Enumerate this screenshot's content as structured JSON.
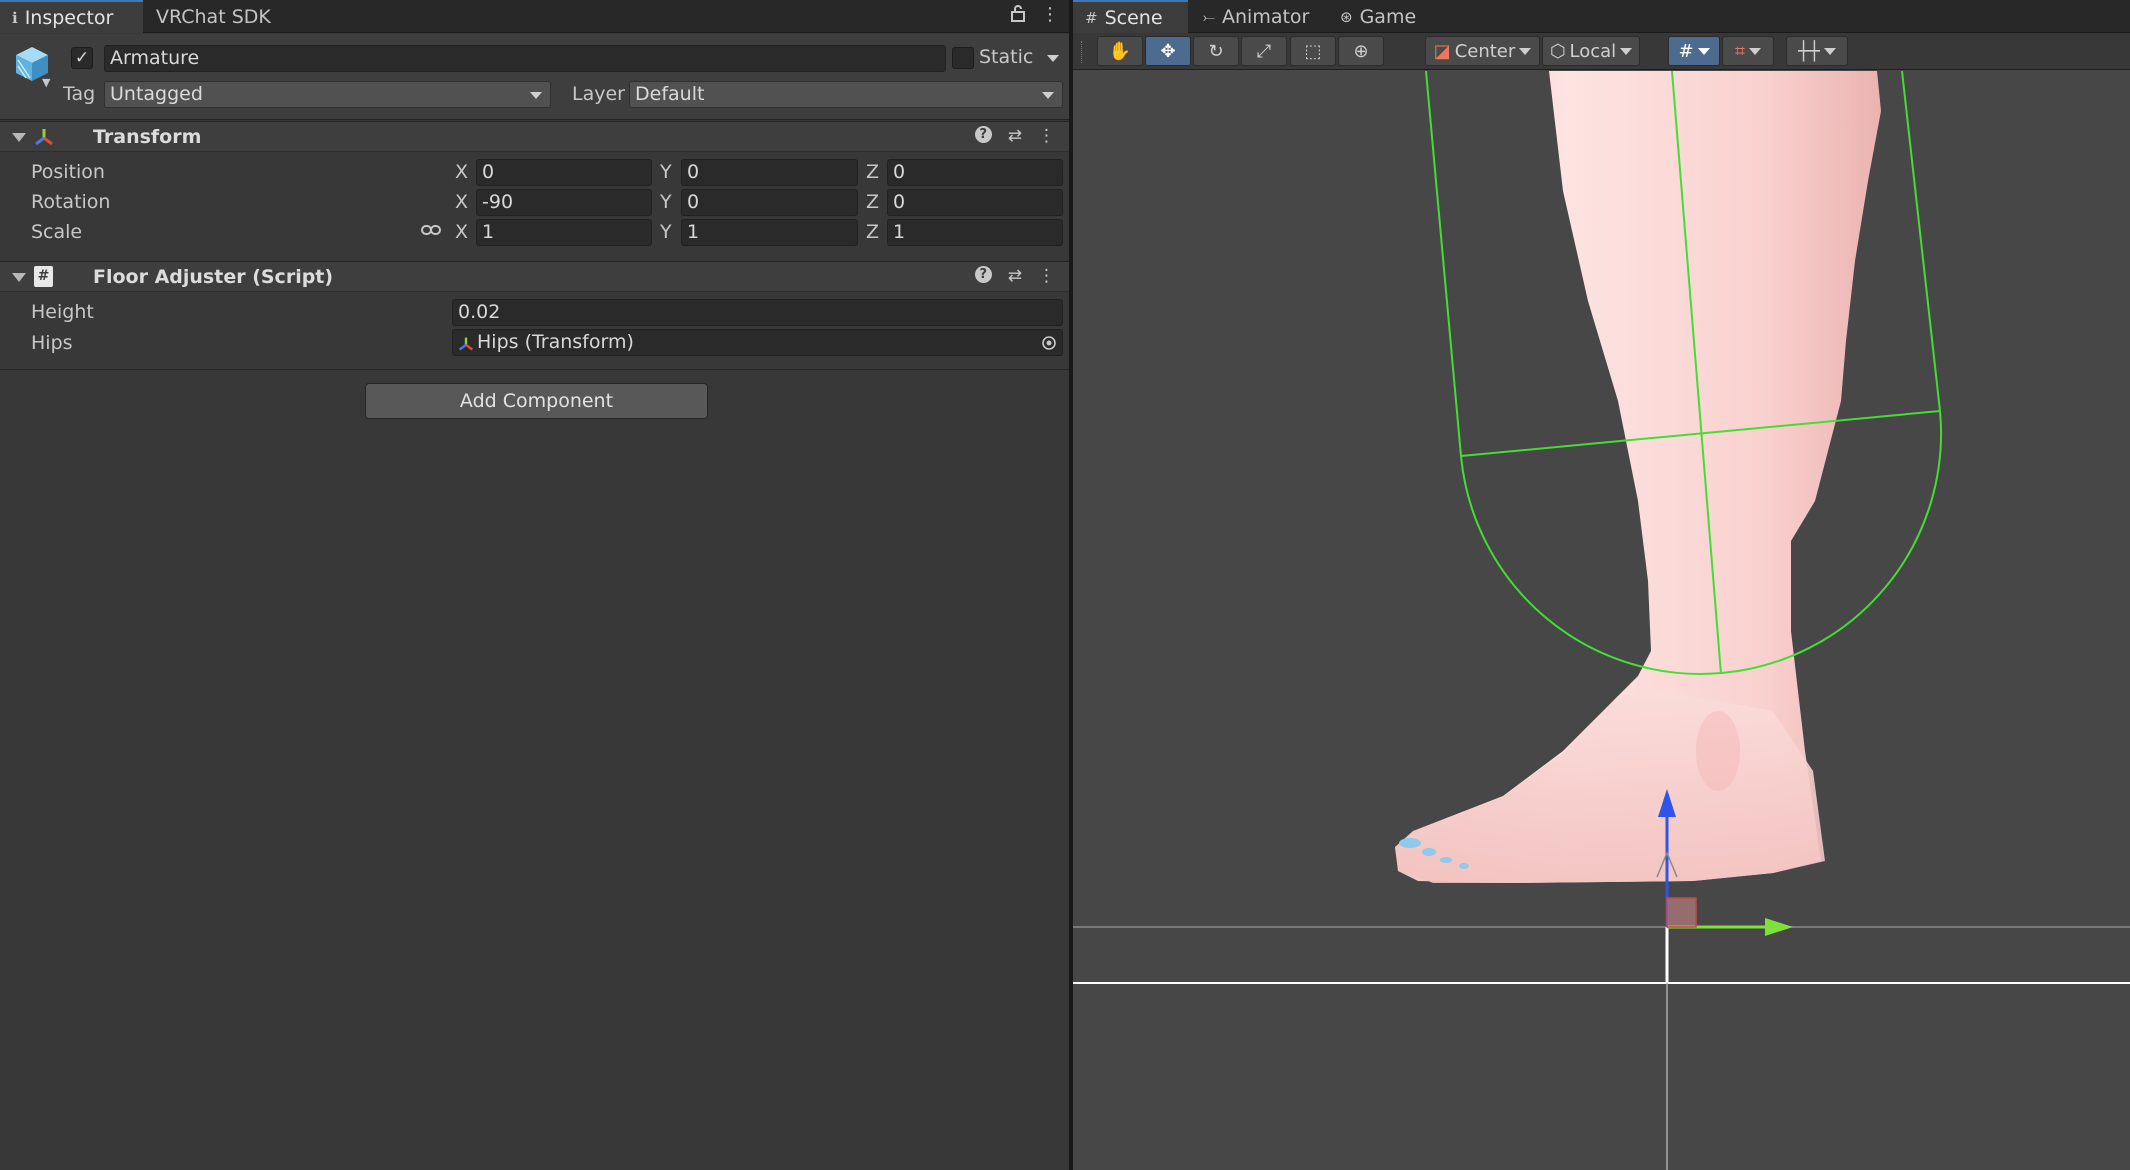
{
  "inspector": {
    "tabs": [
      {
        "label": "Inspector",
        "icon": "info-icon"
      },
      {
        "label": "VRChat SDK"
      }
    ],
    "gameobject": {
      "active": true,
      "name": "Armature",
      "static_label": "Static",
      "tag_label": "Tag",
      "tag_value": "Untagged",
      "layer_label": "Layer",
      "layer_value": "Default"
    },
    "transform": {
      "title": "Transform",
      "position": {
        "label": "Position",
        "x": "0",
        "y": "0",
        "z": "0"
      },
      "rotation": {
        "label": "Rotation",
        "x": "-90",
        "y": "0",
        "z": "0"
      },
      "scale": {
        "label": "Scale",
        "x": "1",
        "y": "1",
        "z": "1"
      },
      "axes": {
        "x": "X",
        "y": "Y",
        "z": "Z"
      }
    },
    "floor_adjuster": {
      "title": "Floor Adjuster (Script)",
      "height_label": "Height",
      "height_value": "0.02",
      "hips_label": "Hips",
      "hips_value": "Hips (Transform)"
    },
    "add_component": "Add Component"
  },
  "scene": {
    "tabs": [
      {
        "label": "Scene",
        "icon": "grid-icon"
      },
      {
        "label": "Animator",
        "icon": "animator-icon"
      },
      {
        "label": "Game",
        "icon": "gamepad-icon"
      }
    ],
    "toolbar": {
      "tools": [
        "hand-tool",
        "move-tool",
        "rotate-tool",
        "scale-tool",
        "rect-tool",
        "transform-tool"
      ],
      "active_tool": "move-tool",
      "pivot_mode": "Center",
      "pivot_rotation": "Local"
    },
    "colors": {
      "collider": "#44dd33",
      "y_axis": "#2f55e8",
      "z_axis": "#7fe03a",
      "skin": "#f7cfcc",
      "toenail": "#8ec9ee"
    }
  }
}
